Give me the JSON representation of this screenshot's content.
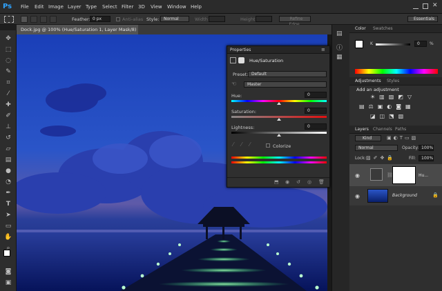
{
  "app": {
    "logo": "Ps"
  },
  "menu": [
    "File",
    "Edit",
    "Image",
    "Layer",
    "Type",
    "Select",
    "Filter",
    "3D",
    "View",
    "Window",
    "Help"
  ],
  "options_bar": {
    "feather_label": "Feather:",
    "feather_value": "0 px",
    "antialias_label": "Anti-alias",
    "style_label": "Style:",
    "style_value": "Normal",
    "width_label": "Width:",
    "height_label": "Height:",
    "refine_button": "Refine Edge...",
    "workspace": "Essentials"
  },
  "document": {
    "tab_label": "Dock.jpg @ 100% (Hue/Saturation 1, Layer Mask/8) *",
    "tab_close": "×"
  },
  "properties": {
    "header": "Properties",
    "title": "Hue/Saturation",
    "preset_label": "Preset:",
    "preset_value": "Default",
    "channel_value": "Master",
    "hue_label": "Hue:",
    "hue_value": "0",
    "saturation_label": "Saturation:",
    "saturation_value": "0",
    "lightness_label": "Lightness:",
    "lightness_value": "0",
    "colorize_label": "Colorize"
  },
  "color_panel": {
    "tab_color": "Color",
    "tab_swatches": "Swatches",
    "k_label": "K",
    "k_value": "0",
    "k_unit": "%"
  },
  "adjustments_panel": {
    "tab_adjustments": "Adjustments",
    "tab_styles": "Styles",
    "heading": "Add an adjustment"
  },
  "layers_panel": {
    "tab_layers": "Layers",
    "tab_channels": "Channels",
    "tab_paths": "Paths",
    "filter_value": "Kind",
    "blend_mode": "Normal",
    "opacity_label": "Opacity:",
    "opacity_value": "100%",
    "lock_label": "Lock:",
    "fill_label": "Fill:",
    "fill_value": "100%",
    "layers": [
      {
        "name": "Hu..."
      },
      {
        "name": "Background"
      }
    ]
  },
  "colors": {
    "accent": "#2fa3ff",
    "panel_bg": "#2f2f2f",
    "sky": "#1b3c9a"
  }
}
